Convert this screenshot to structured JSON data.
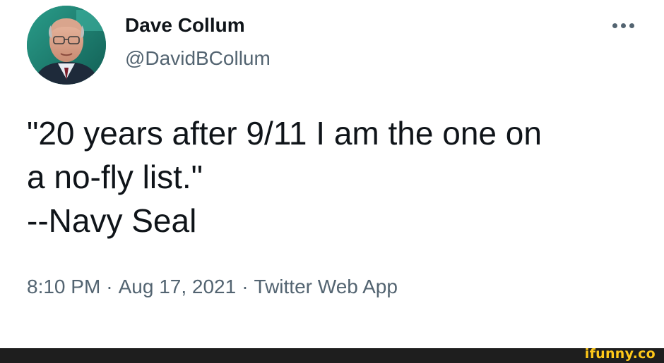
{
  "author": {
    "display_name": "Dave Collum",
    "handle": "@DavidBCollum"
  },
  "more_icon": "ellipsis-icon",
  "tweet": {
    "lines": [
      "\"20 years after 9/11 I am the one on",
      "a no-fly list.\"",
      "--Navy Seal"
    ]
  },
  "meta": {
    "time": "8:10 PM",
    "separator": "·",
    "date": "Aug 17, 2021",
    "source": "Twitter Web App"
  },
  "watermark": {
    "text": "ifunny.co"
  },
  "colors": {
    "text_primary": "#0f1419",
    "text_secondary": "#536471",
    "footer_bg": "#1e1e1e",
    "watermark": "#ffc819"
  }
}
